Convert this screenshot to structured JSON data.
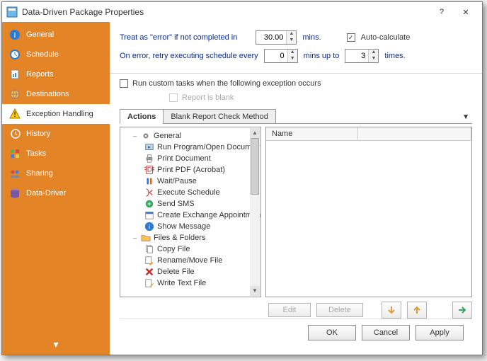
{
  "window": {
    "title": "Data-Driven Package Properties"
  },
  "sidebar": {
    "items": [
      {
        "label": "General",
        "icon": "info"
      },
      {
        "label": "Schedule",
        "icon": "clock"
      },
      {
        "label": "Reports",
        "icon": "report"
      },
      {
        "label": "Destinations",
        "icon": "dest"
      },
      {
        "label": "Exception Handling",
        "icon": "warn",
        "active": true
      },
      {
        "label": "History",
        "icon": "history"
      },
      {
        "label": "Tasks",
        "icon": "tasks"
      },
      {
        "label": "Sharing",
        "icon": "share"
      },
      {
        "label": "Data-Driver",
        "icon": "data"
      }
    ]
  },
  "top": {
    "treatAs": "Treat as \"error\" if not completed in",
    "treatMins": "30.00",
    "minsLabel": "mins.",
    "autoCalc": "Auto-calculate",
    "autoCalcChecked": true,
    "retry": "On error, retry executing schedule every",
    "retryVal": "0",
    "minsUpTo": "mins up to",
    "retryTimes": "3",
    "timesLabel": "times."
  },
  "runCustom": {
    "label": "Run custom tasks when the following exception occurs",
    "checked": false,
    "blank": "Report is blank"
  },
  "tabs": {
    "active": "Actions",
    "other": "Blank Report Check Method"
  },
  "tree": {
    "groups": [
      {
        "label": "General",
        "children": [
          "Run Program/Open Document",
          "Print Document",
          "Print PDF (Acrobat)",
          "Wait/Pause",
          "Execute Schedule",
          "Send SMS",
          "Create Exchange Appointment",
          "Show Message"
        ]
      },
      {
        "label": "Files & Folders",
        "children": [
          "Copy File",
          "Rename/Move File",
          "Delete File",
          "Write Text File"
        ]
      }
    ]
  },
  "list": {
    "col1": "Name"
  },
  "actionbar": {
    "edit": "Edit",
    "delete": "Delete"
  },
  "footer": {
    "ok": "OK",
    "cancel": "Cancel",
    "apply": "Apply"
  }
}
